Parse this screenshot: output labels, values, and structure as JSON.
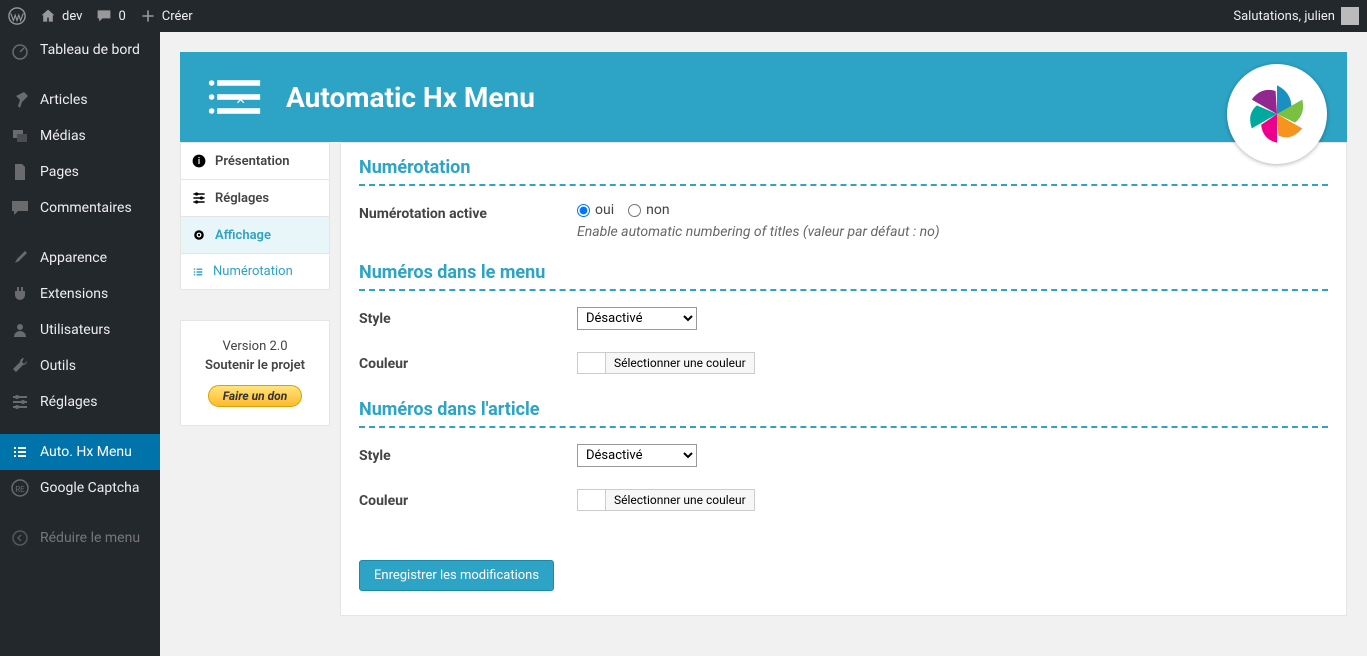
{
  "adminBar": {
    "siteName": "dev",
    "commentCount": "0",
    "newLabel": "Créer",
    "greeting": "Salutations, julien"
  },
  "sidebar": {
    "dashboard": "Tableau de bord",
    "posts": "Articles",
    "media": "Médias",
    "pages": "Pages",
    "comments": "Commentaires",
    "appearance": "Apparence",
    "plugins": "Extensions",
    "users": "Utilisateurs",
    "tools": "Outils",
    "settings": "Réglages",
    "hxmenu": "Auto. Hx Menu",
    "captcha": "Google Captcha",
    "collapse": "Réduire le menu"
  },
  "header": {
    "title": "Automatic Hx Menu"
  },
  "tabs": {
    "presentation": "Présentation",
    "reglages": "Réglages",
    "affichage": "Affichage",
    "numerotation": "Numérotation"
  },
  "donation": {
    "version": "Version 2.0",
    "support": "Soutenir le projet",
    "donate": "Faire un don"
  },
  "form": {
    "section1": "Numérotation",
    "activeLabel": "Numérotation active",
    "yes": "oui",
    "no": "non",
    "activeDesc": "Enable automatic numbering of titles (valeur par défaut : no)",
    "section2": "Numéros dans le menu",
    "styleLabel": "Style",
    "styleValue1": "Désactivé",
    "colorLabel": "Couleur",
    "colorBtn": "Sélectionner une couleur",
    "section3": "Numéros dans l'article",
    "styleValue2": "Désactivé",
    "submit": "Enregistrer les modifications"
  }
}
